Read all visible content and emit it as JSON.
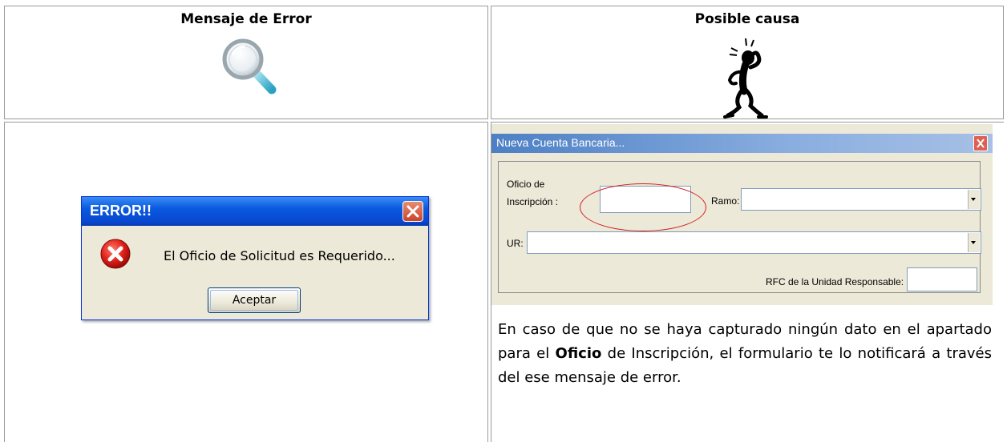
{
  "table": {
    "col1_header": "Mensaje de Error",
    "col2_header": "Posible causa"
  },
  "icons": {
    "col1": "magnifier-icon",
    "col2": "confused-person-icon"
  },
  "error_dialog": {
    "title": "ERROR!!",
    "message": "El Oficio de Solicitud es Requerido...",
    "button": "Aceptar",
    "close_glyph": "✕"
  },
  "form_window": {
    "title": "Nueva Cuenta Bancaria...",
    "close_glyph": "X",
    "oficio_label_line1": "Oficio de",
    "oficio_label_line2": "Inscripción :",
    "ramo_label": "Ramo:",
    "ur_label": "UR:",
    "rfc_label": "RFC de la Unidad Responsable:"
  },
  "explanation": {
    "before_bold": "En caso de que no se haya capturado ningún dato en el apartado para el ",
    "bold": "Oficio",
    "after_bold": " de Inscripción, el formulario te lo notificará a través del ese mensaje de error."
  },
  "colors": {
    "xp_title_blue": "#0a5ae0",
    "dialog_bg": "#ece9d8",
    "oval_red": "#d32020"
  }
}
